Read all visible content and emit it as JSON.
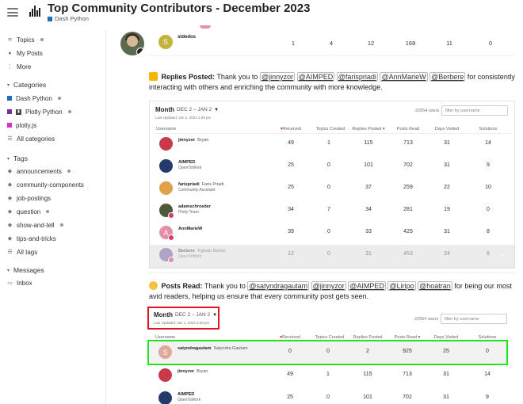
{
  "header": {
    "title": "Top Community Contributors - December 2023",
    "category": "Dash Python",
    "category_color": "#1f6fb8"
  },
  "sidebar": {
    "top_items": [
      {
        "label": "Topics",
        "icon": "layers-icon"
      },
      {
        "label": "My Posts",
        "icon": "user-icon"
      },
      {
        "label": "More",
        "icon": "more-icon"
      }
    ],
    "categories_label": "Categories",
    "categories": [
      {
        "label": "Dash Python",
        "color": "#1f6fb8"
      },
      {
        "label": "Plotly Python",
        "color": "#7b2f8f"
      },
      {
        "label": "plotly.js",
        "color": "#d631c9"
      },
      {
        "label": "All categories",
        "icon": "list-icon"
      }
    ],
    "tags_label": "Tags",
    "tags": [
      {
        "label": "announcements"
      },
      {
        "label": "community-components"
      },
      {
        "label": "job-postings"
      },
      {
        "label": "question"
      },
      {
        "label": "show-and-tell"
      },
      {
        "label": "tips-and-tricks"
      },
      {
        "label": "All tags",
        "icon": "list-icon"
      }
    ],
    "messages_label": "Messages",
    "messages": [
      {
        "label": "Inbox"
      }
    ]
  },
  "top_row": {
    "username": "stdedos",
    "initial": "S",
    "values": [
      "1",
      "4",
      "12",
      "168",
      "11",
      "0"
    ]
  },
  "replies": {
    "heading": "Replies Posted:",
    "pre": "Thank you to",
    "mentions": [
      "@jinnyzor",
      "@AIMPED",
      "@farispriadi",
      "@AnnMarieW",
      "@Berbere"
    ],
    "post": "for consistently interacting with others and enriching the community with more knowledge.",
    "panel": {
      "period": "Month",
      "range": "DEC 2 – JAN 2",
      "updated": "Last Updated: Jan 1, 2024 3:38 pm",
      "users": "22654 users",
      "filter_placeholder": "filter by username",
      "columns": [
        "Username",
        "Received",
        "Topics Created",
        "Replies Posted",
        "Posts Read",
        "Days Visited",
        "Solutions"
      ],
      "rows": [
        {
          "user": "jinnyzor",
          "name": "Bryan",
          "sub": "",
          "values": [
            "49",
            "1",
            "115",
            "713",
            "31",
            "14"
          ]
        },
        {
          "user": "AIMPED",
          "name": "",
          "sub": "OpenToWork",
          "values": [
            "25",
            "0",
            "101",
            "702",
            "31",
            "9"
          ]
        },
        {
          "user": "farispriadi",
          "name": "Faris Priadi",
          "sub": "Community Assistant",
          "values": [
            "25",
            "0",
            "37",
            "259",
            "22",
            "10"
          ]
        },
        {
          "user": "adamschroeder",
          "name": "",
          "sub": "Plotly Team",
          "values": [
            "34",
            "7",
            "34",
            "281",
            "19",
            "0"
          ]
        },
        {
          "user": "AnnMarieW",
          "name": "",
          "sub": "",
          "initial": "A",
          "values": [
            "39",
            "0",
            "33",
            "425",
            "31",
            "8"
          ]
        },
        {
          "user": "Berbere",
          "name": "Yigbalp Berber",
          "sub": "OpenToWork",
          "values": [
            "12",
            "0",
            "31",
            "453",
            "24",
            "6"
          ]
        }
      ]
    }
  },
  "posts_read": {
    "heading": "Posts Read:",
    "pre": "Thank you to",
    "mentions": [
      "@satyndragautam",
      "@jinnyzor",
      "@AIMPED",
      "@Liripo",
      "@hoatran"
    ],
    "post": "for being our most avid readers, helping us ensure that every community post gets seen.",
    "panel": {
      "period": "Month",
      "range": "DEC 2 – JAN 2",
      "updated": "Last Updated: Jan 1, 2024 3:38 pm",
      "users": "22654 users",
      "filter_placeholder": "filter by username",
      "columns": [
        "Username",
        "Received",
        "Topics Created",
        "Replies Posted",
        "Posts Read",
        "Days Visited",
        "Solutions"
      ],
      "rows": [
        {
          "user": "satyndragautam",
          "name": "Satyndra Gautam",
          "sub": "",
          "initial": "S",
          "values": [
            "0",
            "0",
            "2",
            "925",
            "25",
            "0"
          ]
        },
        {
          "user": "jinnyzor",
          "name": "Bryan",
          "sub": "",
          "values": [
            "49",
            "1",
            "115",
            "713",
            "31",
            "14"
          ]
        },
        {
          "user": "AIMPED",
          "name": "",
          "sub": "OpenToWork",
          "values": [
            "25",
            "0",
            "101",
            "702",
            "31",
            "9"
          ]
        }
      ]
    }
  }
}
